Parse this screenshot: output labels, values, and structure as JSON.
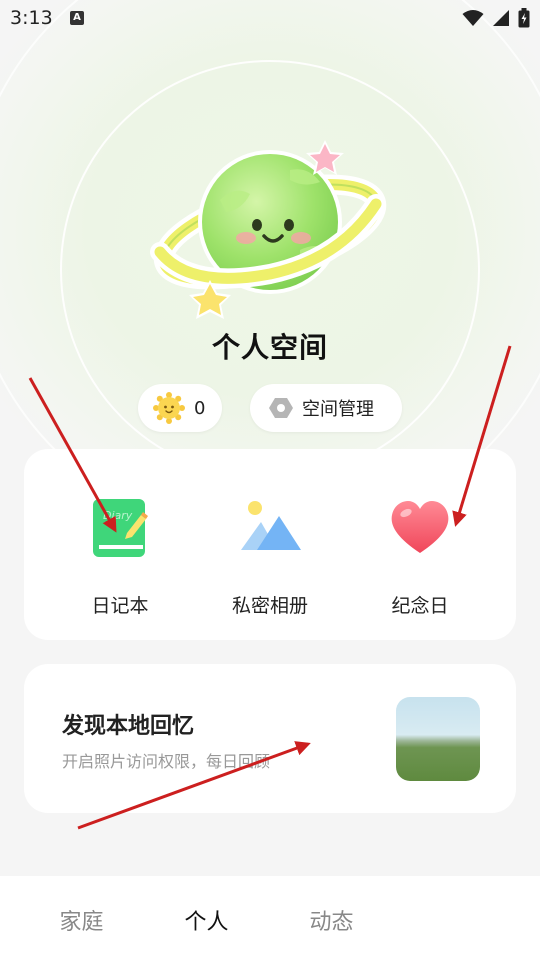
{
  "status_bar": {
    "time": "3:13",
    "notification_letter": "A",
    "icons": [
      "wifi-icon",
      "signal-icon",
      "battery-icon"
    ]
  },
  "header": {
    "title": "个人空间"
  },
  "chips": {
    "sun_count": "0",
    "manage_label": "空间管理"
  },
  "features": [
    {
      "label": "日记本",
      "icon": "diary-icon"
    },
    {
      "label": "私密相册",
      "icon": "album-icon"
    },
    {
      "label": "纪念日",
      "icon": "heart-icon"
    }
  ],
  "memory": {
    "title": "发现本地回忆",
    "subtitle": "开启照片访问权限，每日回顾"
  },
  "bottom_nav": {
    "items": [
      "家庭",
      "个人",
      "动态"
    ],
    "active": "个人"
  },
  "colors": {
    "accent_green": "#8fd962",
    "ring_yellow": "#f2f06a",
    "diary_green": "#3fd67a",
    "heart_red": "#f45b6b",
    "annotation_arrow": "#cc1f1f"
  }
}
